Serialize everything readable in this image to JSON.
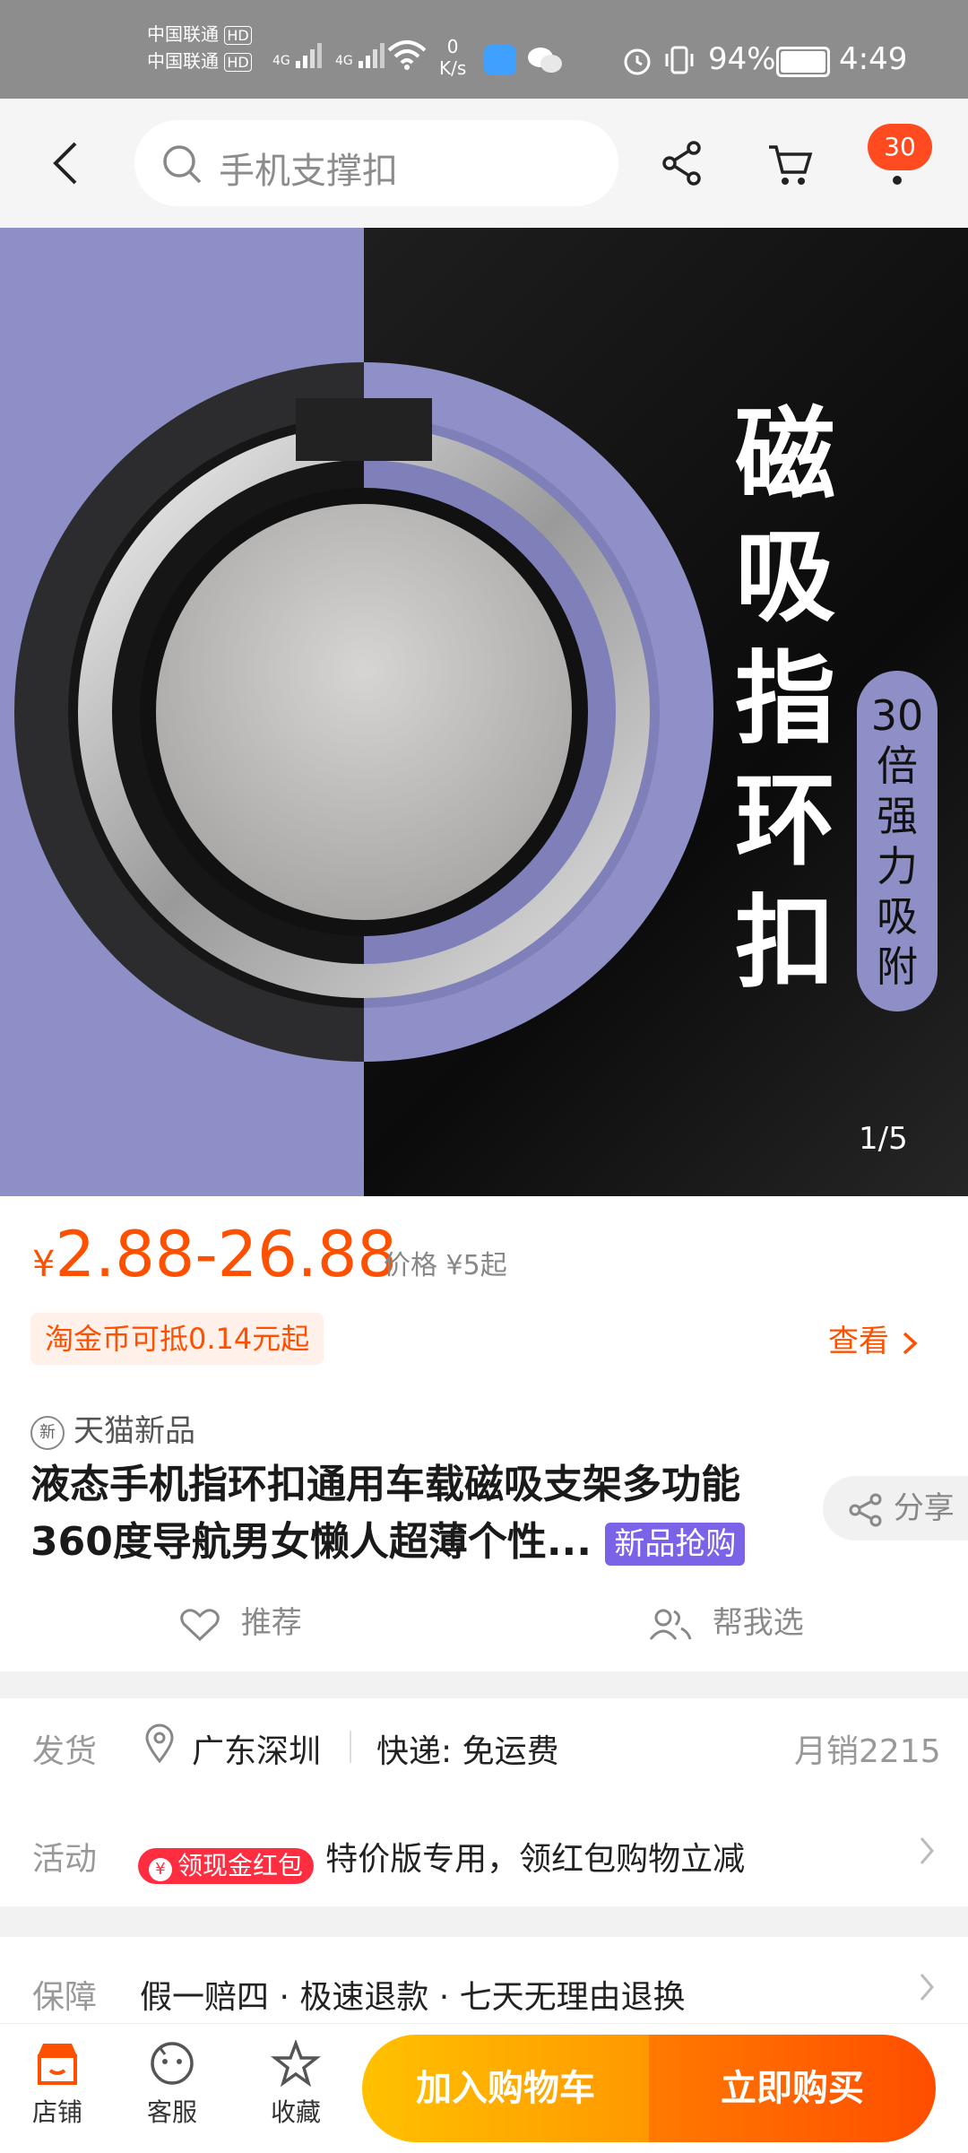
{
  "status_bar": {
    "carrier1": "中国联通",
    "carrier2": "中国联通",
    "hd1": "HD",
    "hd2": "HD",
    "net1": "4G",
    "net2": "4G",
    "speed_value": "0",
    "speed_unit": "K/s",
    "battery": "94%",
    "time": "4:49"
  },
  "header": {
    "search_placeholder": "手机支撑扣",
    "cart_badge": "30"
  },
  "hero": {
    "headline": "磁吸指环扣",
    "pill_text": "30倍强力吸附",
    "counter": "1/5"
  },
  "price": {
    "currency": "¥",
    "range": "2.88-26.88",
    "ref_label": "价格",
    "ref_value": "¥5起",
    "coupon": "淘金币可抵0.14元起",
    "view_label": "查看"
  },
  "product": {
    "new_tag_icon": "新",
    "new_label": "天猫新品",
    "title": "液态手机指环扣通用车载磁吸支架多功能360度导航男女懒人超薄个性...",
    "title_tag": "新品抢购",
    "share_label": "分享",
    "recommend_label": "推荐",
    "help_label": "帮我选"
  },
  "info": {
    "ship_label": "发货",
    "ship_location": "广东深圳",
    "ship_express": "快递: 免运费",
    "monthly_sales": "月销2215",
    "activity_label": "活动",
    "activity_tag": "领现金红包",
    "activity_text": "特价版专用，领红包购物立减",
    "guarantee_label": "保障",
    "guarantee_text": "假一赔四 · 极速退款 · 七天无理由退换"
  },
  "bottom_bar": {
    "store": "店铺",
    "service": "客服",
    "favorite": "收藏",
    "add_to_cart": "加入购物车",
    "buy_now": "立即购买"
  },
  "colors": {
    "accent": "#ff5000",
    "hero_purple": "#8e8fc6"
  }
}
